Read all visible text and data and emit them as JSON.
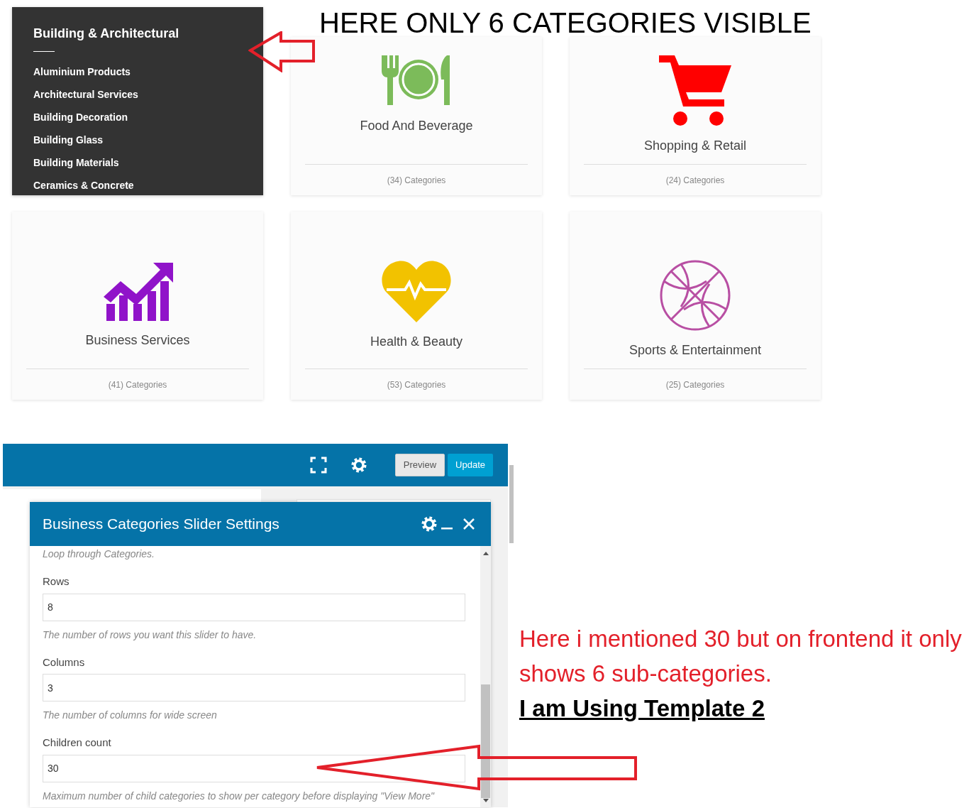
{
  "headline": "HERE ONLY 6 CATEGORIES VISIBLE",
  "categories": [
    {
      "title": "Building & Architectural",
      "hovered": true,
      "children": [
        "Aluminium Products",
        "Architectural Services",
        "Building Decoration",
        "Building Glass",
        "Building Materials",
        "Ceramics & Concrete"
      ]
    },
    {
      "title": "Food And Beverage",
      "hovered": false,
      "count": "(34) Categories"
    },
    {
      "title": "Shopping & Retail",
      "hovered": false,
      "count": "(24) Categories"
    },
    {
      "title": "Business Services",
      "hovered": false,
      "count": "(41) Categories"
    },
    {
      "title": "Health & Beauty",
      "hovered": false,
      "count": "(53) Categories"
    },
    {
      "title": "Sports & Entertainment",
      "hovered": false,
      "count": "(25) Categories"
    }
  ],
  "builder": {
    "buttons": [
      {
        "label": "Preview",
        "kind": "secondary"
      },
      {
        "label": "Update",
        "kind": "primary"
      }
    ]
  },
  "dialog": {
    "title": "Business Categories Slider Settings",
    "intro": "Loop through Categories.",
    "fields": [
      {
        "label": "Rows",
        "value": "8",
        "help": "The number of rows you want this slider to have."
      },
      {
        "label": "Columns",
        "value": "3",
        "help": "The number of columns for wide screen"
      },
      {
        "label": "Children count",
        "value": "30",
        "help": "Maximum number of child categories to show per category before displaying \"View More\""
      }
    ]
  },
  "annotation": {
    "text": "Here i mentioned 30 but on frontend it only shows 6 sub-categories.",
    "emphasis": "I am Using Template 2"
  }
}
